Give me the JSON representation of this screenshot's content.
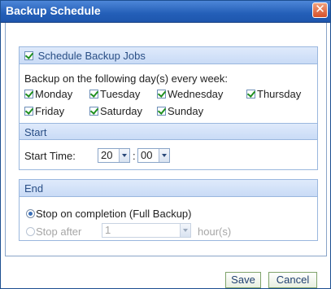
{
  "window": {
    "title": "Backup Schedule",
    "close_glyph": "✕"
  },
  "schedule": {
    "checkbox_label": "Schedule Backup Jobs",
    "intro": "Backup on the following day(s) every week:",
    "days": [
      {
        "label": "Monday",
        "checked": true
      },
      {
        "label": "Tuesday",
        "checked": true
      },
      {
        "label": "Wednesday",
        "checked": true
      },
      {
        "label": "Thursday",
        "checked": true
      },
      {
        "label": "Friday",
        "checked": true
      },
      {
        "label": "Saturday",
        "checked": true
      },
      {
        "label": "Sunday",
        "checked": true
      }
    ]
  },
  "start": {
    "header": "Start",
    "time_label": "Start Time:",
    "hour": "20",
    "separator": ":",
    "minute": "00"
  },
  "end": {
    "header": "End",
    "option_completion": "Stop on completion (Full Backup)",
    "option_after_prefix": "Stop after",
    "option_after_value": "1",
    "option_after_unit": "hour(s)",
    "selected": "completion"
  },
  "buttons": {
    "save": "Save",
    "cancel": "Cancel"
  }
}
